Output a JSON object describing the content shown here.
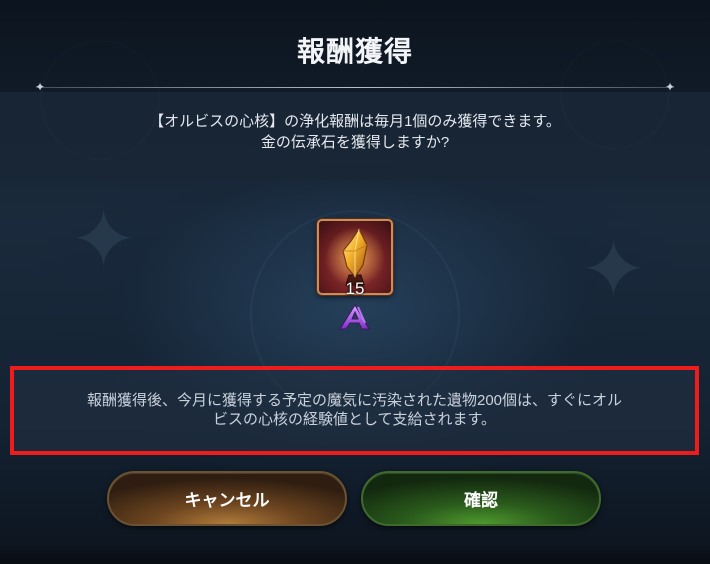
{
  "dialog": {
    "title": "報酬獲得",
    "question_line1": "【オルビスの心核】の浄化報酬は毎月1個のみ獲得できます。",
    "question_line2": "金の伝承石を獲得しますか?"
  },
  "reward": {
    "icon": "golden-lore-stone-icon",
    "count": "15",
    "rank_icon": "rank-a-icon"
  },
  "notice": {
    "line1": "報酬獲得後、今月に獲得する予定の魔気に汚染された遺物200個は、すぐにオル",
    "line2": "ビスの心核の経験値として支給されます。",
    "highlight_color": "#ee1c1c"
  },
  "buttons": {
    "cancel_label": "キャンセル",
    "confirm_label": "確認"
  }
}
